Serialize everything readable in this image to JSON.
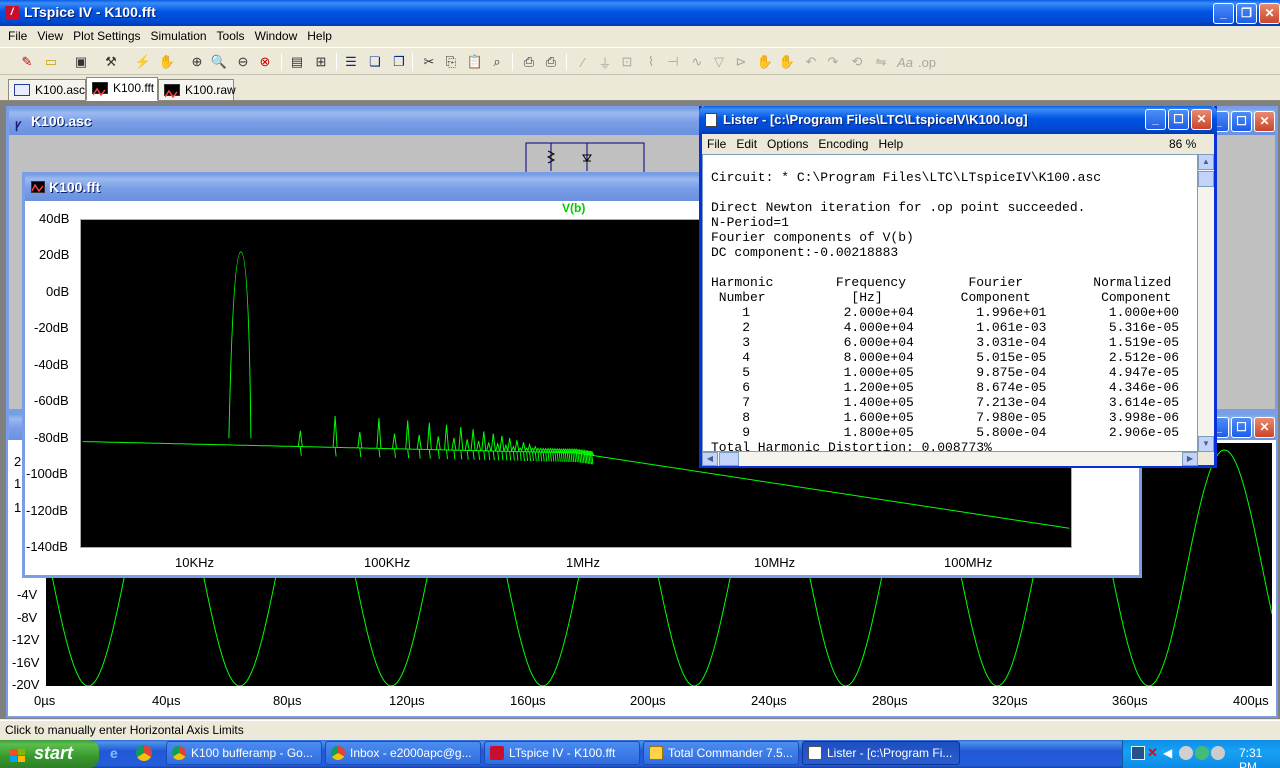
{
  "app": {
    "title": "LTspice IV - K100.fft",
    "icon": "ltspice-logo-icon"
  },
  "menu": [
    "File",
    "View",
    "Plot Settings",
    "Simulation",
    "Tools",
    "Window",
    "Help"
  ],
  "tabs": [
    {
      "label": "K100.asc",
      "icon": "schematic-icon",
      "active": false
    },
    {
      "label": "K100.fft",
      "icon": "waveform-icon",
      "active": true
    },
    {
      "label": "K100.raw",
      "icon": "waveform-icon",
      "active": false
    }
  ],
  "asc_window": {
    "title": "K100.asc"
  },
  "fft_window": {
    "title": "K100.fft",
    "trace_label": "V(b)",
    "trace_color": "#00ff00",
    "y_ticks": [
      "40dB",
      "20dB",
      "0dB",
      "-20dB",
      "-40dB",
      "-60dB",
      "-80dB",
      "-100dB",
      "-120dB",
      "-140dB"
    ],
    "x_ticks": [
      "10KHz",
      "100KHz",
      "1MHz",
      "10MHz",
      "100MHz"
    ]
  },
  "time_window": {
    "y_ticks_partial": [
      "2",
      "1",
      "1"
    ],
    "y_ticks": [
      "-4V",
      "-8V",
      "-12V",
      "-16V",
      "-20V"
    ],
    "x_ticks": [
      "0µs",
      "40µs",
      "80µs",
      "120µs",
      "160µs",
      "200µs",
      "240µs",
      "280µs",
      "320µs",
      "360µs",
      "400µs"
    ]
  },
  "lister": {
    "title": "Lister - [c:\\Program Files\\LTC\\LtspiceIV\\K100.log]",
    "menu": [
      "File",
      "Edit",
      "Options",
      "Encoding",
      "Help"
    ],
    "zoom": "86 %",
    "circuit_line": "Circuit: * C:\\Program Files\\LTC\\LTspiceIV\\K100.asc",
    "lines": [
      "Direct Newton iteration for .op point succeeded.",
      "N-Period=1",
      "Fourier components of V(b)",
      "DC component:-0.00218883"
    ],
    "header1": "Harmonic        Frequency        Fourier         Normalized",
    "header2": " Number           [Hz]          Component         Component",
    "rows": [
      "    1            2.000e+04        1.996e+01        1.000e+00",
      "    2            4.000e+04        1.061e-03        5.316e-05",
      "    3            6.000e+04        3.031e-04        1.519e-05",
      "    4            8.000e+04        5.015e-05        2.512e-06",
      "    5            1.000e+05        9.875e-04        4.947e-05",
      "    6            1.200e+05        8.674e-05        4.346e-06",
      "    7            1.400e+05        7.213e-04        3.614e-05",
      "    8            1.600e+05        7.980e-05        3.998e-06",
      "    9            1.800e+05        5.800e-04        2.906e-05"
    ],
    "thd": "Total Harmonic Distortion: 0.008773%"
  },
  "status": {
    "text": "Click to manually enter Horizontal Axis Limits"
  },
  "taskbar": {
    "start_label": "start",
    "tasks": [
      {
        "label": "K100 bufferamp - Go...",
        "icon": "chrome-icon",
        "active": false
      },
      {
        "label": "Inbox - e2000apc@g...",
        "icon": "chrome-icon",
        "active": false
      },
      {
        "label": "LTspice IV - K100.fft",
        "icon": "ltspice-icon",
        "active": false
      },
      {
        "label": "Total Commander 7.5...",
        "icon": "total-commander-icon",
        "active": false
      },
      {
        "label": "Lister - [c:\\Program Fi...",
        "icon": "lister-icon",
        "active": true
      }
    ],
    "clock": "7:31 PM"
  }
}
